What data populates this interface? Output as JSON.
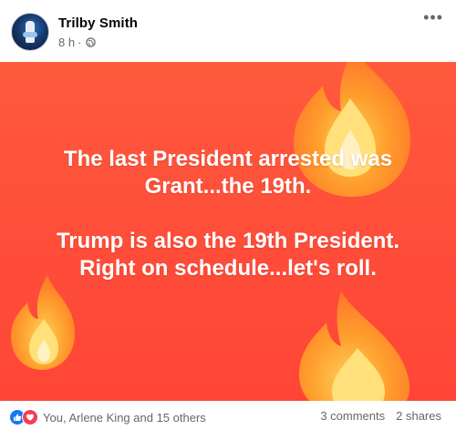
{
  "post": {
    "author": "Trilby Smith",
    "time": "8 h",
    "separator": "·",
    "privacy_icon": "globe-icon",
    "more_icon": "more-options-icon",
    "more_label": "•••"
  },
  "image": {
    "background_color": "#ff4f3a",
    "lines": [
      "The last President arrested was",
      "Grant...the 19th.",
      "Trump is also the 19th President.",
      "Right on schedule...let's roll."
    ],
    "decorations": [
      "fire-emoji-top-right",
      "fire-emoji-bottom-left",
      "fire-emoji-bottom-right"
    ]
  },
  "footer": {
    "reaction_icons": [
      "like-icon",
      "love-icon"
    ],
    "reaction_text": "You, Arlene King and 15 others",
    "comments": "3 comments",
    "shares": "2 shares"
  },
  "colors": {
    "like": "#1877f2",
    "love": "#f33e58",
    "secondary_text": "#65676b"
  }
}
